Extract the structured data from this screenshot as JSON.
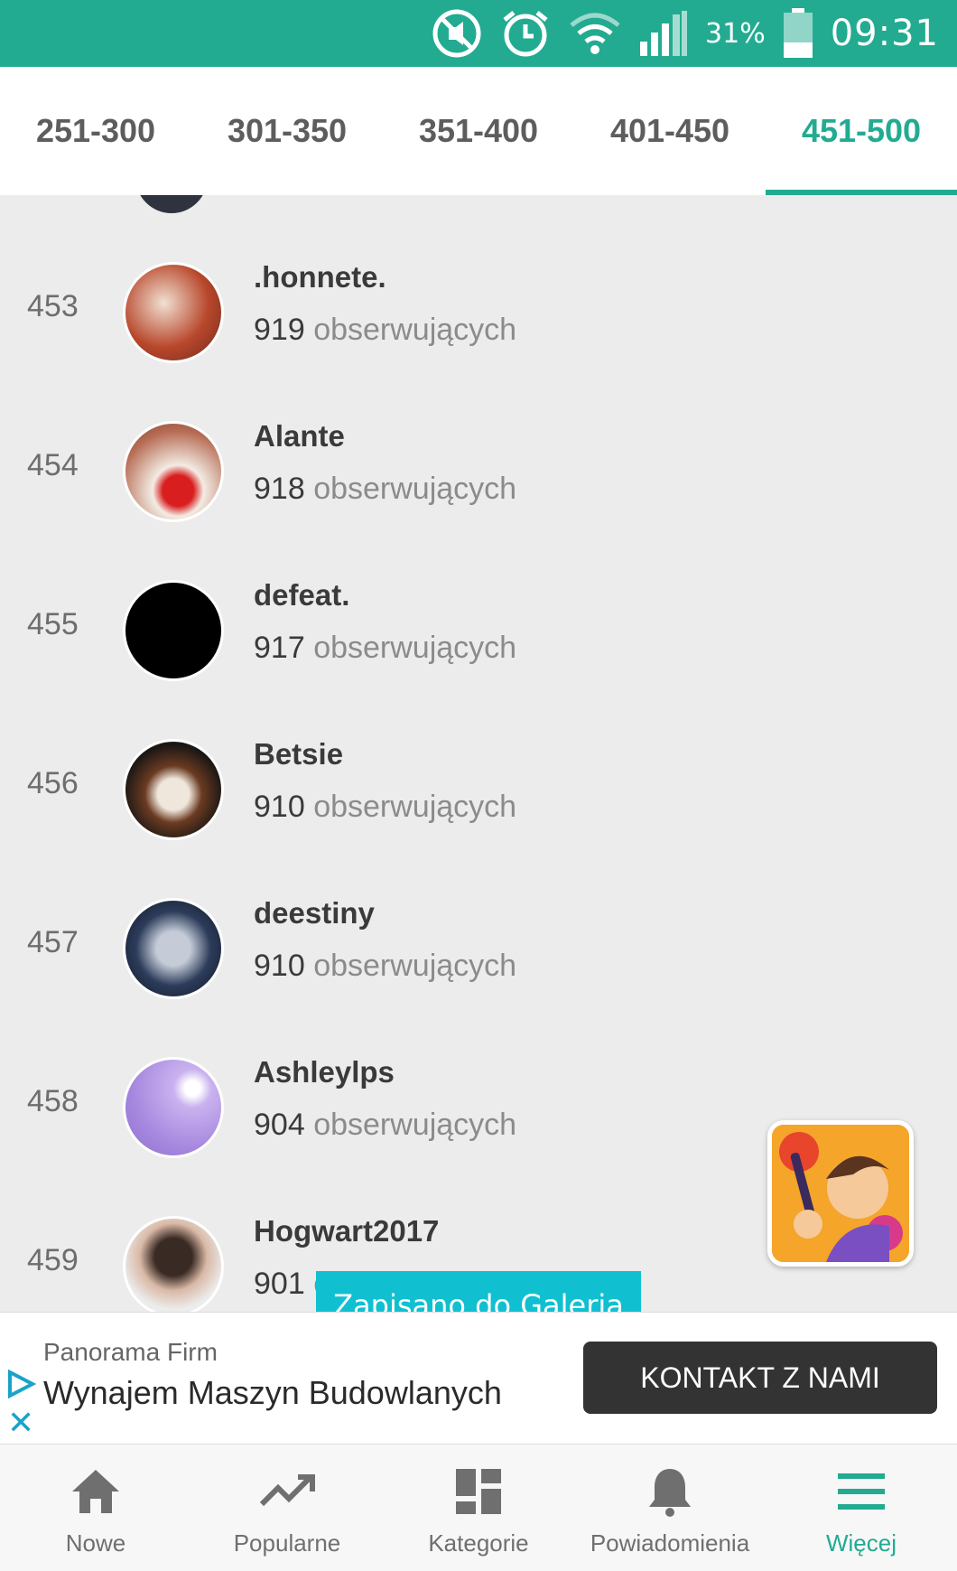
{
  "status_bar": {
    "battery_percent": "31%",
    "time": "09:31",
    "icons": [
      "mute-icon",
      "alarm-icon",
      "wifi-icon",
      "signal-icon",
      "battery-icon"
    ]
  },
  "tabs": [
    {
      "label": "251-300",
      "active": false
    },
    {
      "label": "301-350",
      "active": false
    },
    {
      "label": "351-400",
      "active": false
    },
    {
      "label": "401-450",
      "active": false
    },
    {
      "label": "451-500",
      "active": true
    }
  ],
  "list": {
    "followers_suffix": "obserwujących",
    "items": [
      {
        "rank": "453",
        "name": ".honnete.",
        "followers": "919"
      },
      {
        "rank": "454",
        "name": "Alante",
        "followers": "918"
      },
      {
        "rank": "455",
        "name": "defeat.",
        "followers": "917"
      },
      {
        "rank": "456",
        "name": "Betsie",
        "followers": "910"
      },
      {
        "rank": "457",
        "name": "deestiny",
        "followers": "910"
      },
      {
        "rank": "458",
        "name": "Ashleylps",
        "followers": "904"
      },
      {
        "rank": "459",
        "name": "Hogwart2017",
        "followers": "901"
      }
    ]
  },
  "toast": {
    "text": "Zapisano do Galeria"
  },
  "ad": {
    "brand": "Panorama Firm",
    "title": "Wynajem Maszyn Budowlanych",
    "cta": "KONTAKT Z NAMI"
  },
  "bottom_nav": [
    {
      "label": "Nowe",
      "icon": "home-icon",
      "active": false
    },
    {
      "label": "Popularne",
      "icon": "trending-icon",
      "active": false
    },
    {
      "label": "Kategorie",
      "icon": "grid-icon",
      "active": false
    },
    {
      "label": "Powiadomienia",
      "icon": "bell-icon",
      "active": false
    },
    {
      "label": "Więcej",
      "icon": "menu-icon",
      "active": true
    }
  ],
  "colors": {
    "accent": "#22ab91",
    "toast": "#10c0d0",
    "cta": "#333333"
  }
}
